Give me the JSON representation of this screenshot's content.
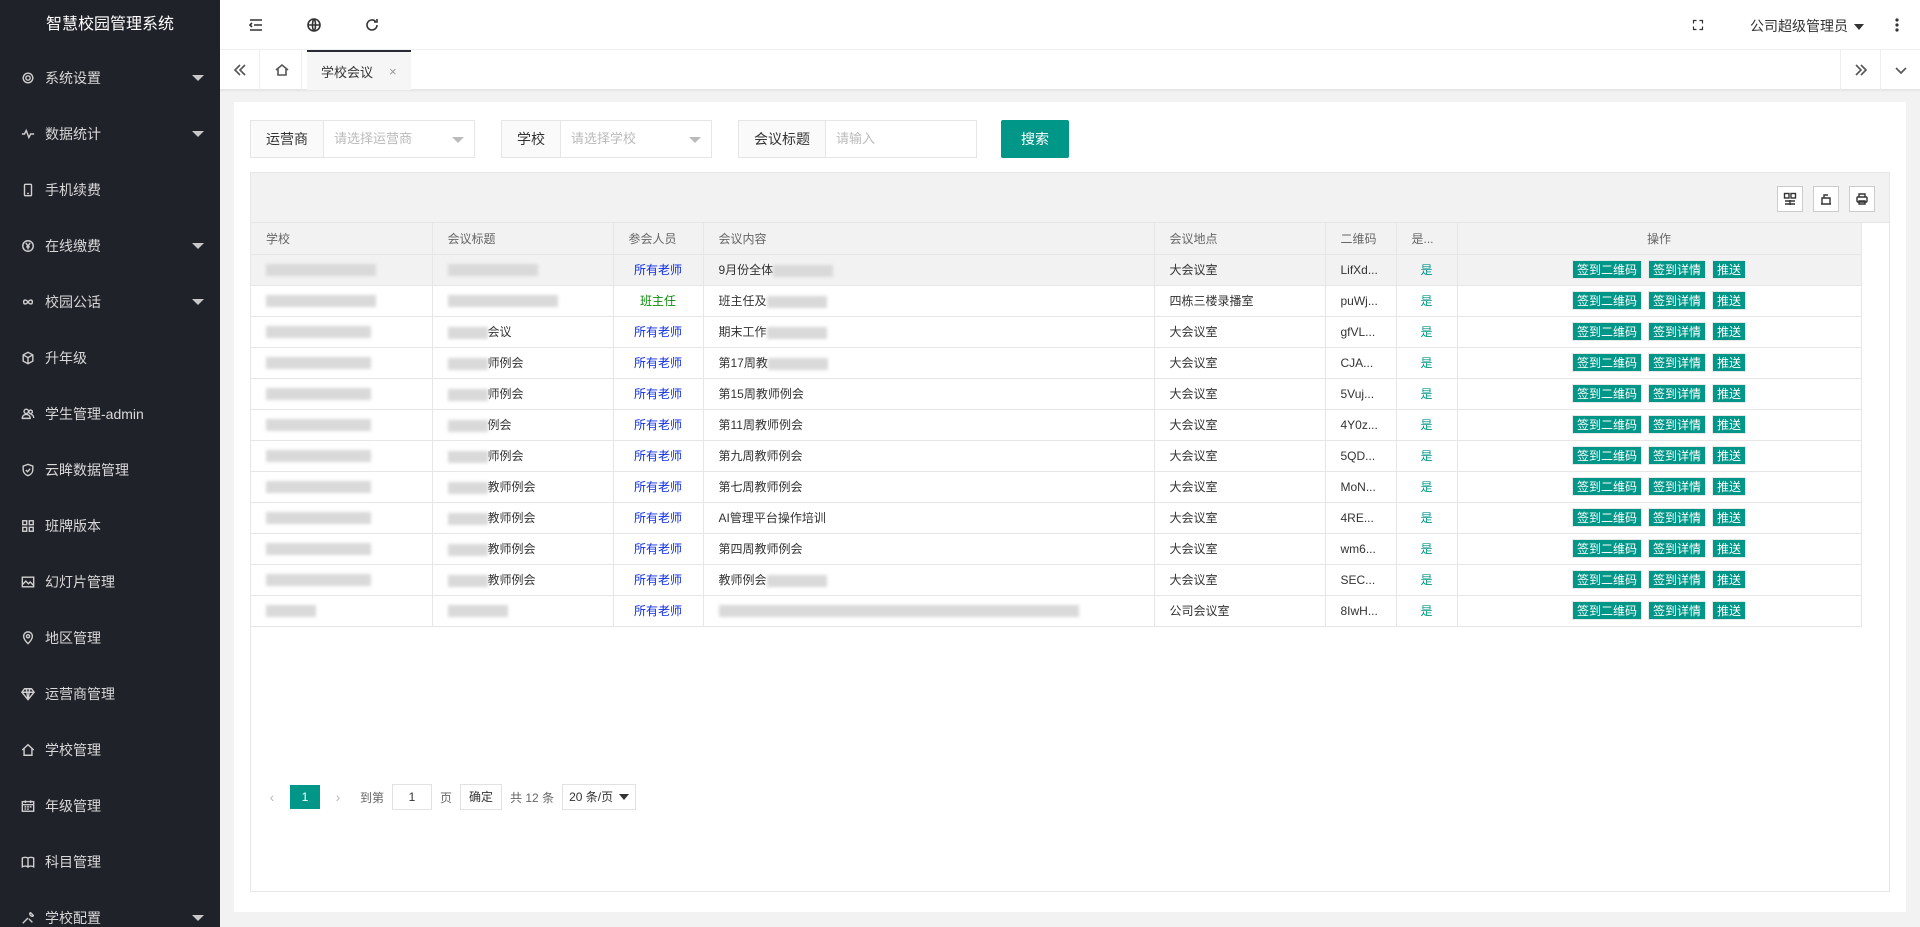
{
  "app": {
    "title": "智慧校园管理系统"
  },
  "header": {
    "user": "公司超级管理员"
  },
  "sidebar": {
    "items": [
      {
        "label": "系统设置",
        "icon": "gear-icon",
        "expandable": true
      },
      {
        "label": "数据统计",
        "icon": "pulse-icon",
        "expandable": true
      },
      {
        "label": "手机续费",
        "icon": "phone-icon",
        "expandable": false
      },
      {
        "label": "在线缴费",
        "icon": "yen-icon",
        "expandable": true
      },
      {
        "label": "校园公话",
        "icon": "infinity-icon",
        "expandable": true
      },
      {
        "label": "升年级",
        "icon": "cube-icon",
        "expandable": false
      },
      {
        "label": "学生管理-admin",
        "icon": "users-icon",
        "expandable": false
      },
      {
        "label": "云眸数据管理",
        "icon": "shield-icon",
        "expandable": false
      },
      {
        "label": "班牌版本",
        "icon": "apps-icon",
        "expandable": false
      },
      {
        "label": "幻灯片管理",
        "icon": "image-icon",
        "expandable": false
      },
      {
        "label": "地区管理",
        "icon": "location-icon",
        "expandable": false
      },
      {
        "label": "运营商管理",
        "icon": "diamond-icon",
        "expandable": false
      },
      {
        "label": "学校管理",
        "icon": "home-icon",
        "expandable": false
      },
      {
        "label": "年级管理",
        "icon": "calendar-icon",
        "expandable": false
      },
      {
        "label": "科目管理",
        "icon": "book-icon",
        "expandable": false
      },
      {
        "label": "学校配置",
        "icon": "tools-icon",
        "expandable": true
      }
    ]
  },
  "tabs": {
    "active": "学校会议",
    "close": "×"
  },
  "search": {
    "operator_label": "运营商",
    "operator_placeholder": "请选择运营商",
    "school_label": "学校",
    "school_placeholder": "请选择学校",
    "title_label": "会议标题",
    "title_placeholder": "请输入",
    "button": "搜索"
  },
  "table": {
    "headers": [
      "学校",
      "会议标题",
      "参会人员",
      "会议内容",
      "会议地点",
      "二维码",
      "是...",
      "操作"
    ],
    "ops": [
      "签到二维码",
      "签到详情",
      "推送"
    ],
    "rows": [
      {
        "school": "",
        "title": "",
        "attendees": "所有老师",
        "attend_color": "blue",
        "content": "9月份全体",
        "location": "大会议室",
        "qr": "LifXd...",
        "flag": "是"
      },
      {
        "school": "",
        "title": "",
        "attendees": "班主任",
        "attend_color": "green",
        "content": "班主任及",
        "location": "四栋三楼录播室",
        "qr": "puWj...",
        "flag": "是"
      },
      {
        "school": "",
        "title": "会议",
        "attendees": "所有老师",
        "attend_color": "blue",
        "content": "期末工作",
        "location": "大会议室",
        "qr": "gfVL...",
        "flag": "是"
      },
      {
        "school": "",
        "title": "师例会",
        "attendees": "所有老师",
        "attend_color": "blue",
        "content": "第17周教",
        "location": "大会议室",
        "qr": "CJA...",
        "flag": "是"
      },
      {
        "school": "",
        "title": "师例会",
        "attendees": "所有老师",
        "attend_color": "blue",
        "content": "第15周教师例会",
        "location": "大会议室",
        "qr": "5Vuj...",
        "flag": "是"
      },
      {
        "school": "",
        "title": "例会",
        "attendees": "所有老师",
        "attend_color": "blue",
        "content": "第11周教师例会",
        "location": "大会议室",
        "qr": "4Y0z...",
        "flag": "是"
      },
      {
        "school": "",
        "title": "师例会",
        "attendees": "所有老师",
        "attend_color": "blue",
        "content": "第九周教师例会",
        "location": "大会议室",
        "qr": "5QD...",
        "flag": "是"
      },
      {
        "school": "",
        "title": "教师例会",
        "attendees": "所有老师",
        "attend_color": "blue",
        "content": "第七周教师例会",
        "location": "大会议室",
        "qr": "MoN...",
        "flag": "是"
      },
      {
        "school": "",
        "title": "教师例会",
        "attendees": "所有老师",
        "attend_color": "blue",
        "content": "AI管理平台操作培训",
        "location": "大会议室",
        "qr": "4RE...",
        "flag": "是"
      },
      {
        "school": "",
        "title": "教师例会",
        "attendees": "所有老师",
        "attend_color": "blue",
        "content": "第四周教师例会",
        "location": "大会议室",
        "qr": "wm6...",
        "flag": "是"
      },
      {
        "school": "",
        "title": "教师例会",
        "attendees": "所有老师",
        "attend_color": "blue",
        "content": "教师例会",
        "location": "大会议室",
        "qr": "SEC...",
        "flag": "是"
      },
      {
        "school": "",
        "title": "",
        "attendees": "所有老师",
        "attend_color": "blue",
        "content": "",
        "location": "公司会议室",
        "qr": "8IwH...",
        "flag": "是"
      }
    ]
  },
  "pagination": {
    "current": "1",
    "goto_label": "到第",
    "goto_value": "1",
    "page_unit": "页",
    "confirm": "确定",
    "total": "共 12 条",
    "page_size": "20 条/页"
  },
  "colors": {
    "accent": "#009688",
    "sidebar_bg": "#20222a",
    "blue_text": "#0d2de6",
    "green_text": "#0b8a0b"
  }
}
